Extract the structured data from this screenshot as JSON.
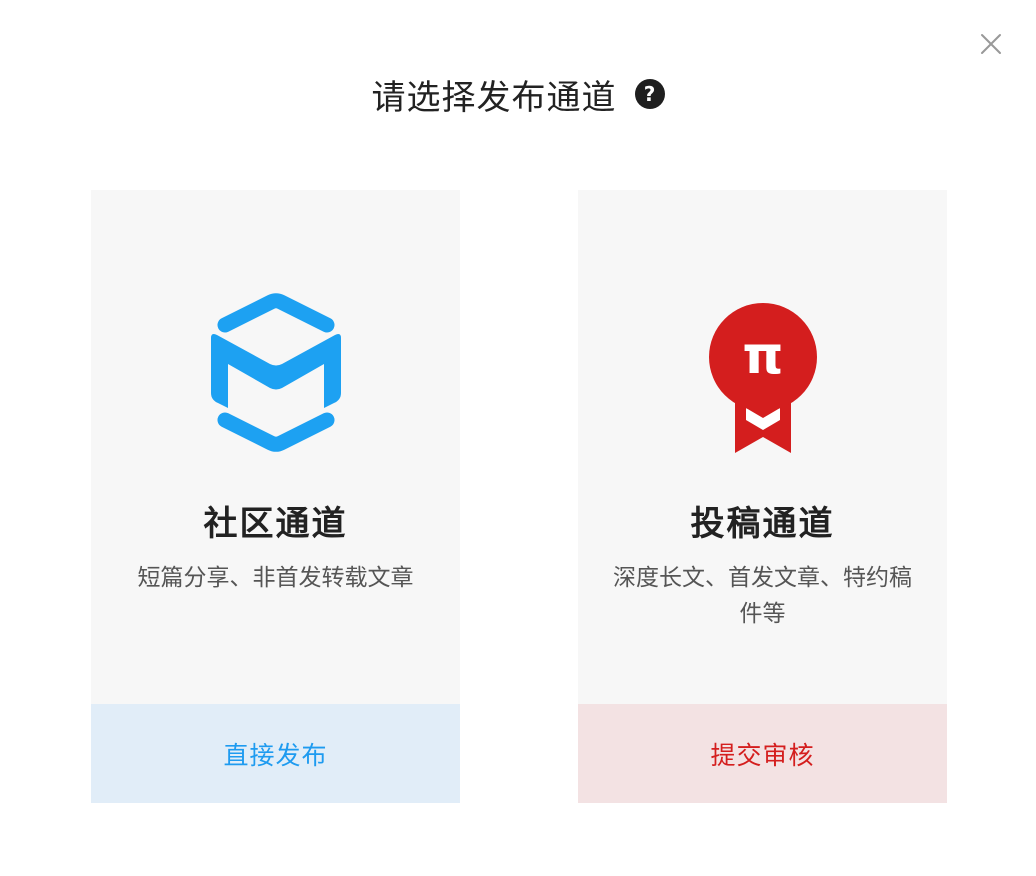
{
  "dialog": {
    "title": "请选择发布通道",
    "help_icon": "?"
  },
  "cards": [
    {
      "icon": "community-cube-icon",
      "title": "社区通道",
      "description": "短篇分享、非首发转载文章",
      "button_label": "直接发布",
      "accent": "#1e9bf0"
    },
    {
      "icon": "pi-medal-icon",
      "icon_text": "π",
      "title": "投稿通道",
      "description": "深度长文、首发文章、特约稿件等",
      "button_label": "提交审核",
      "accent": "#d41e1e"
    }
  ]
}
